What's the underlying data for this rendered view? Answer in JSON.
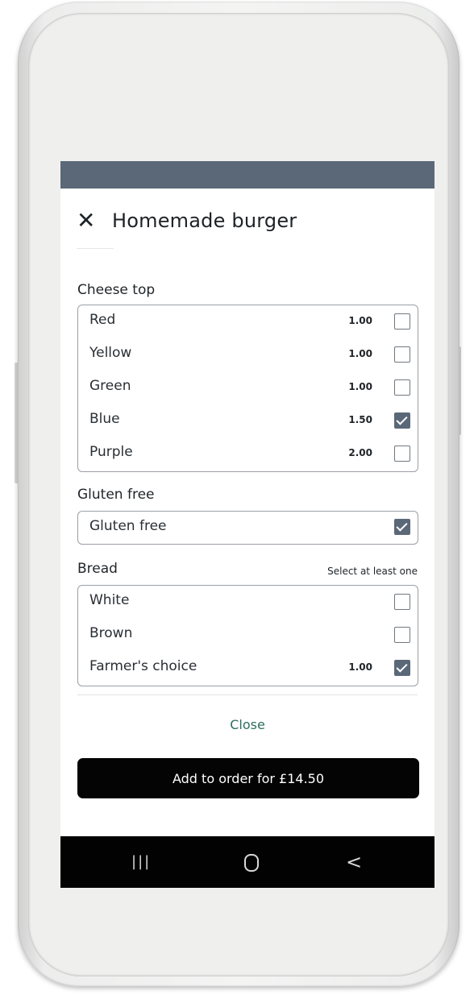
{
  "header": {
    "close_icon": "close-icon",
    "title": "Homemade burger"
  },
  "cheese": {
    "label": "Cheese top",
    "options": [
      {
        "label": "Red",
        "price": "1.00",
        "checked": false
      },
      {
        "label": "Yellow",
        "price": "1.00",
        "checked": false
      },
      {
        "label": "Green",
        "price": "1.00",
        "checked": false
      },
      {
        "label": "Blue",
        "price": "1.50",
        "checked": true
      },
      {
        "label": "Purple",
        "price": "2.00",
        "checked": false
      }
    ]
  },
  "gluten": {
    "label": "Gluten free",
    "options": [
      {
        "label": "Gluten free",
        "price": "",
        "checked": true
      }
    ]
  },
  "bread": {
    "label": "Bread",
    "hint": "Select at least one",
    "options": [
      {
        "label": "White",
        "price": "",
        "checked": false
      },
      {
        "label": "Brown",
        "price": "",
        "checked": false
      },
      {
        "label": "Farmer's choice",
        "price": "1.00",
        "checked": true
      }
    ]
  },
  "footer": {
    "close_label": "Close",
    "cta_label": "Add to order for £14.50"
  },
  "navbar": {
    "recent": "|||",
    "back": "<"
  },
  "colors": {
    "accent": "#5b6878",
    "link": "#2d6e5e",
    "cta": "#040404"
  }
}
